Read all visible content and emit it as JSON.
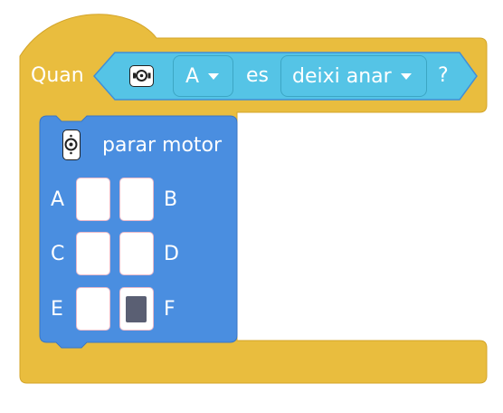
{
  "block": {
    "hat_label": "Quan",
    "condition": {
      "motor_selector": "A",
      "operator_label": "es",
      "state_selector": "deixi anar",
      "question_mark": "?"
    },
    "inner": {
      "title": "parar motor",
      "ports": [
        {
          "label": "A",
          "selected": false
        },
        {
          "label": "B",
          "selected": false
        },
        {
          "label": "C",
          "selected": false
        },
        {
          "label": "D",
          "selected": false
        },
        {
          "label": "E",
          "selected": false
        },
        {
          "label": "F",
          "selected": true
        }
      ]
    }
  },
  "colors": {
    "hat_block": "#e9bd3e",
    "condition_block": "#55c4e6",
    "motor_block": "#4a8ee0",
    "selected_square": "#5a5f73"
  },
  "icons": {
    "condition_icon": "motor-icon",
    "inner_icon": "motor-icon"
  }
}
